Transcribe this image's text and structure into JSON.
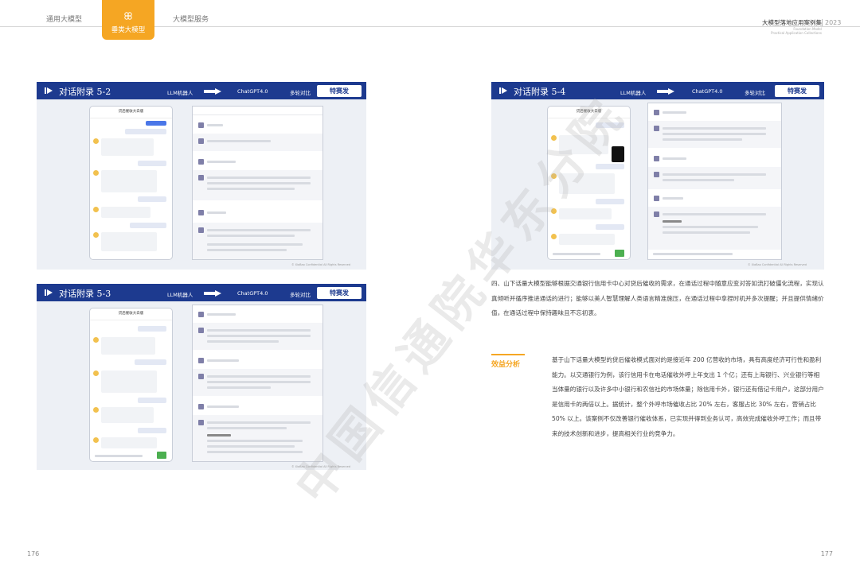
{
  "header": {
    "tabs": [
      "通用大模型",
      "垂类大模型",
      "大模型服务"
    ],
    "active_tab": "垂类大模型",
    "book_title": "大模型落地应用案例集",
    "book_subtitle_1": "Foundation Model",
    "book_subtitle_2": "Practical Application Collections",
    "year": "2023"
  },
  "panels": [
    {
      "title": "对话附录 5-2",
      "llm": "LLM机器人",
      "gpt": "ChatGPT4.0",
      "multi": "多轮对比",
      "logo": "特赛发",
      "phone_title": "贷后催收大白版",
      "copyright": "© XiaBao Confidential All Rights Reserved"
    },
    {
      "title": "对话附录 5-3",
      "llm": "LLM机器人",
      "gpt": "ChatGPT4.0",
      "multi": "多轮对比",
      "logo": "特赛发",
      "phone_title": "贷后催收大白版",
      "copyright": "© XiaBao Confidential All Rights Reserved"
    },
    {
      "title": "对话附录 5-4",
      "llm": "LLM机器人",
      "gpt": "ChatGPT4.0",
      "multi": "多轮对比",
      "logo": "特赛发",
      "phone_title": "贷后催收大白版",
      "copyright": "© XiaBao Confidential All Rights Reserved"
    }
  ],
  "body": {
    "paragraph": "四、山下话量大模型能够根据交通银行信用卡中心对贷后催收的需求，在通话过程中随意应变对答如流打破僵化流程，实现认真倾听并循序推进通话的进行；能够以美人智慧理解人类语言精准施压，在通话过程中拿捏时机并多次提醒；并且提供情绪价值，在通话过程中保持趣味且不忘初衷。",
    "benefit_label": "效益分析",
    "benefit_text": "基于山下话量大模型的贷后催收模式面对的是接近年 200 亿营收的市场，具有高度经济可行性和盈利能力。以交通银行为例，该行信用卡在电话催收外呼上年支出 1 个亿；还有上海银行、兴业银行等相当体量的银行以及许多中小银行和农信社的市场体量；除信用卡外，银行还有借记卡用户，这部分用户是信用卡的两倍以上。据统计，整个外呼市场催收占比 20% 左右，客服占比 30% 左右，营销占比 50% 以上。该案例不仅改善银行催收体系，已实现并得到业务认可，高效完成催收外呼工作；而且带来的技术创新和进步，提高相关行业的竞争力。"
  },
  "page_numbers": {
    "left": "176",
    "right": "177"
  },
  "watermark": "中国信通院华东分院",
  "colors": {
    "accent": "#f5a623",
    "banner": "#1d3a8f"
  }
}
